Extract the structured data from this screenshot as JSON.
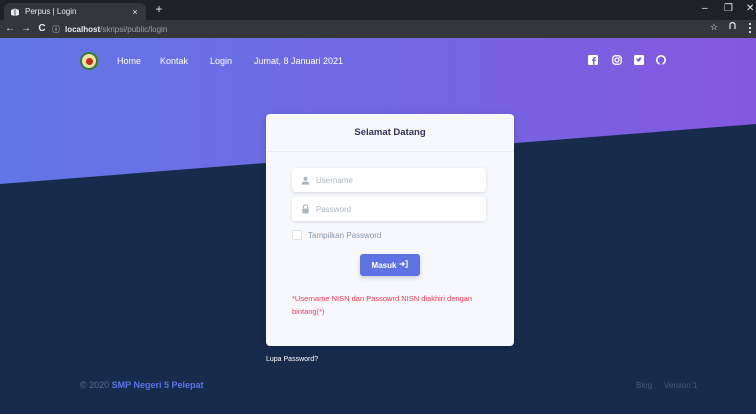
{
  "browser": {
    "tab_title": "Perpus | Login",
    "tab_close": "×",
    "new_tab": "+",
    "minimize": "–",
    "restore": "❐",
    "close": "✕",
    "back": "←",
    "forward": "→",
    "reload": "C",
    "info_icon": "ⓘ",
    "url_host": "localhost",
    "url_path": "/skripsi/public/login",
    "bookmark_star": "☆"
  },
  "navbar": {
    "links": [
      "Home",
      "Kontak",
      "Login"
    ],
    "date": "Jumat, 8 Januari 2021",
    "social_icons": [
      "facebook-icon",
      "instagram-icon",
      "twitter-icon",
      "github-icon"
    ]
  },
  "login": {
    "title": "Selamat Datang",
    "username_placeholder": "Username",
    "password_placeholder": "Password",
    "show_password_label": "Tampilkan Password",
    "submit_label": "Masuk",
    "notice": "*Username NISN dan Passowrd NISN diakhiri dengan bintang(*)"
  },
  "forgot_password": "Lupa Password?",
  "footer": {
    "copyright": "© 2020",
    "brand": "SMP Negeri 5 Pelepat",
    "links": [
      "Blog",
      "Version 1"
    ]
  },
  "colors": {
    "hero_gradient_start": "#6177e6",
    "hero_gradient_end": "#8358df",
    "page_background": "#172b4d",
    "primary_button": "#5e72e4",
    "notice_text": "#f5365c"
  }
}
